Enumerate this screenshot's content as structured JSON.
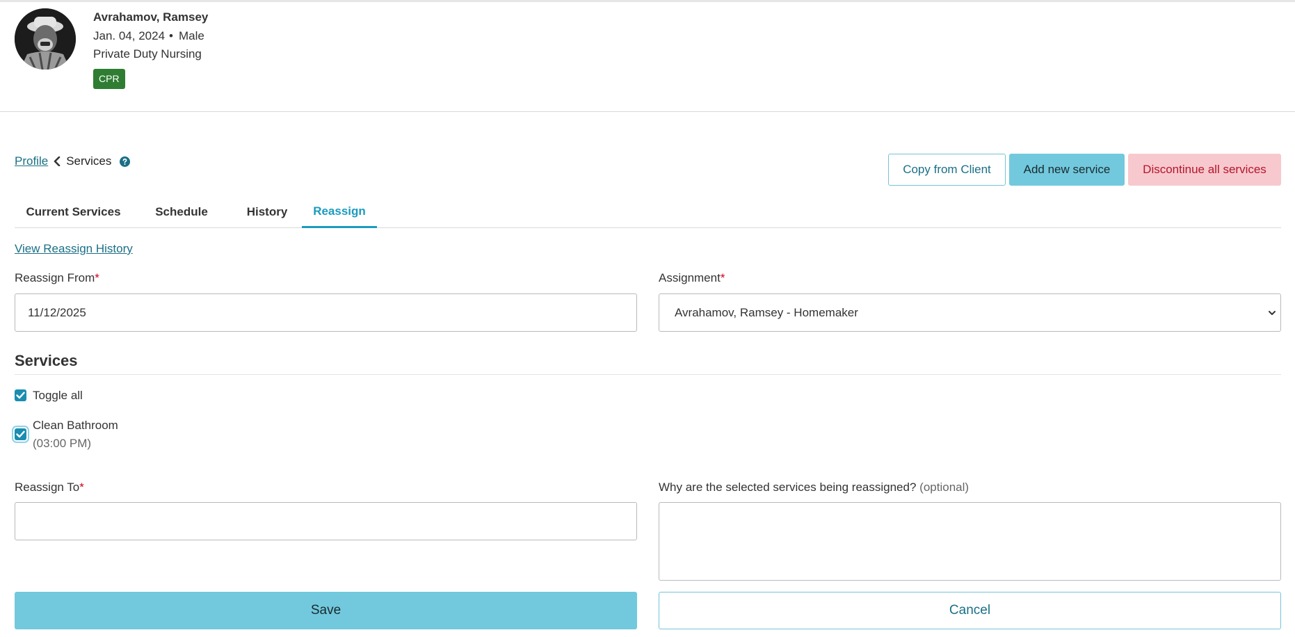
{
  "client": {
    "name": "Avrahamov, Ramsey",
    "dob": "Jan. 04, 2024",
    "separator": "•",
    "gender": "Male",
    "program": "Private Duty Nursing",
    "badge": "CPR"
  },
  "breadcrumb": {
    "profile_link": "Profile",
    "current": "Services"
  },
  "actions": {
    "copy": "Copy from Client",
    "add": "Add new service",
    "discontinue": "Discontinue all services"
  },
  "tabs": [
    {
      "label": "Current Services",
      "active": false
    },
    {
      "label": "Schedule",
      "active": false
    },
    {
      "label": "History",
      "active": false
    },
    {
      "label": "Reassign",
      "active": true
    }
  ],
  "reassign": {
    "history_link": "View Reassign History",
    "from_label": "Reassign From",
    "from_value": "11/12/2025",
    "assignment_label": "Assignment",
    "assignment_value": "Avrahamov, Ramsey - Homemaker",
    "required_mark": "*",
    "services_heading": "Services",
    "toggle_all_label": "Toggle all",
    "services": [
      {
        "name": "Clean Bathroom",
        "time": "(03:00 PM)",
        "checked": true
      }
    ],
    "to_label": "Reassign To",
    "to_value": "",
    "reason_label": "Why are the selected services being reassigned?",
    "reason_optional": "(optional)",
    "reason_value": "",
    "save": "Save",
    "cancel": "Cancel"
  },
  "colors": {
    "accent": "#1a9bc0",
    "primary_button": "#72c9dd",
    "danger_bg": "#f7c9ce",
    "danger_text": "#b3152b",
    "badge_green": "#2e7d32",
    "required": "#d0021b"
  }
}
